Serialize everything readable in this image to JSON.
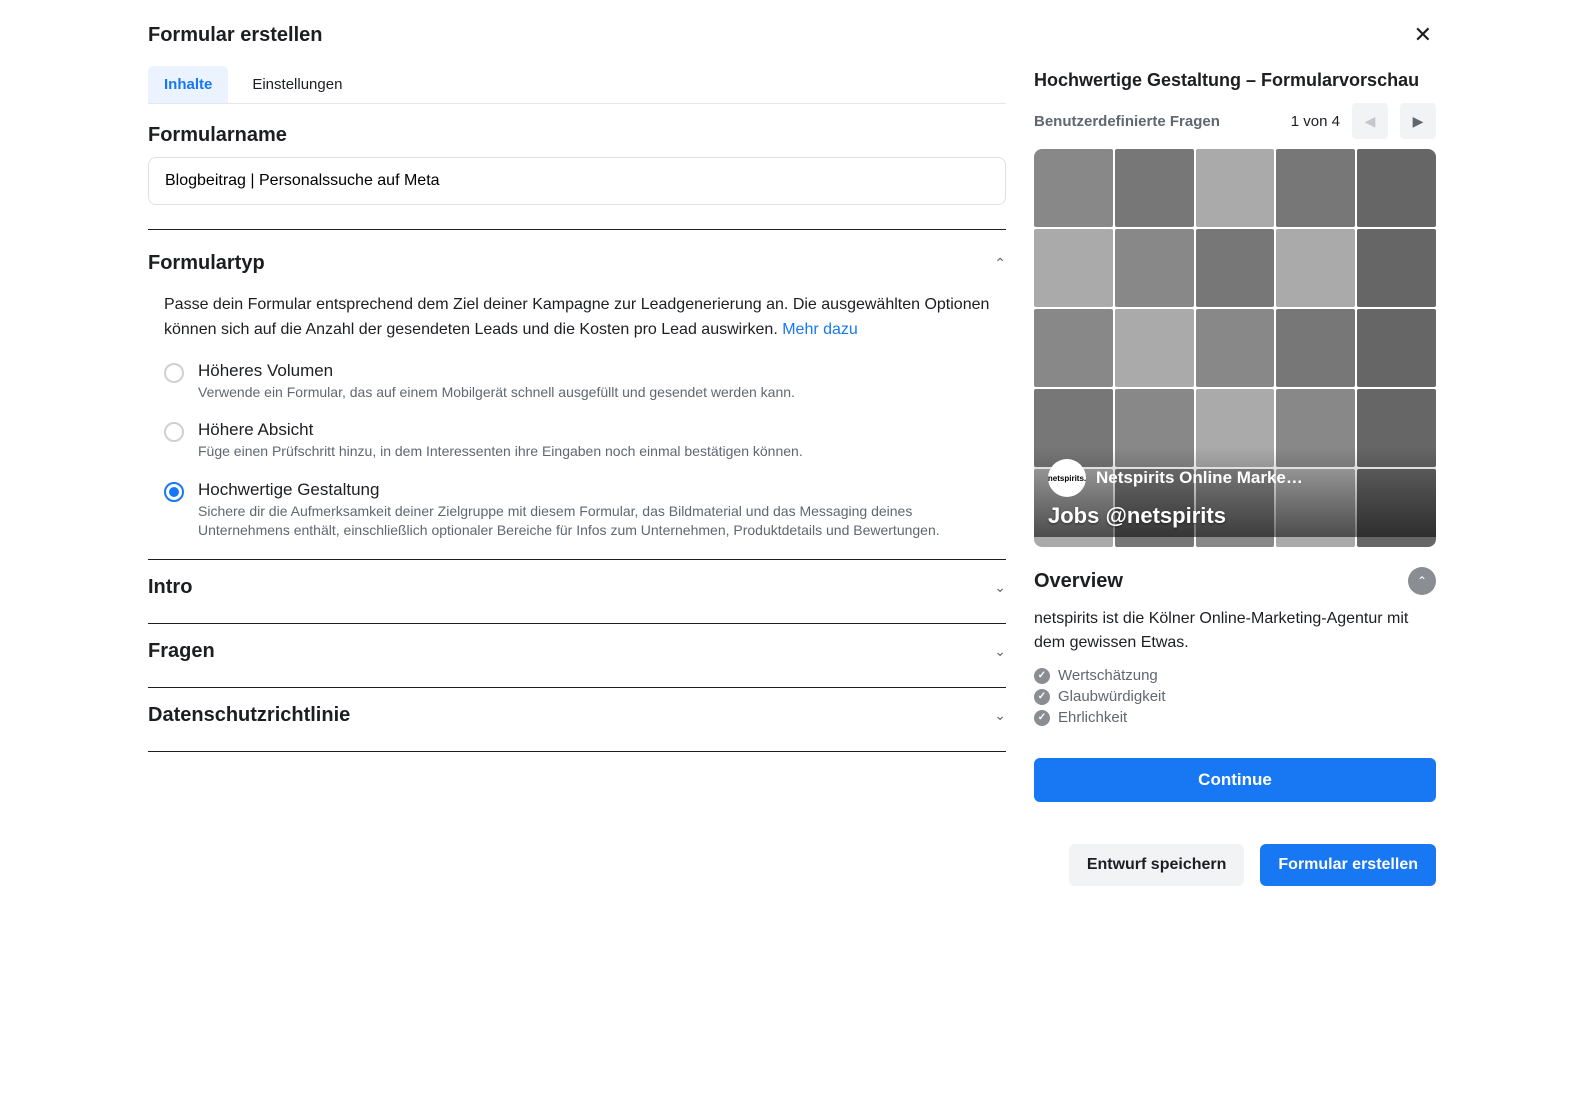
{
  "header": {
    "title": "Formular erstellen"
  },
  "tabs": [
    {
      "label": "Inhalte",
      "active": true
    },
    {
      "label": "Einstellungen",
      "active": false
    }
  ],
  "formName": {
    "label": "Formularname",
    "value": "Blogbeitrag | Personalssuche auf Meta"
  },
  "formType": {
    "heading": "Formulartyp",
    "descriptionPrefix": "Passe dein Formular entsprechend dem Ziel deiner Kampagne zur Leadgenerierung an. Die ausgewählten Optionen können sich auf die Anzahl der gesendeten Leads und die Kosten pro Lead auswirken. ",
    "learnMore": "Mehr dazu",
    "options": [
      {
        "title": "Höheres Volumen",
        "sub": "Verwende ein Formular, das auf einem Mobilgerät schnell ausgefüllt und gesendet werden kann.",
        "selected": false
      },
      {
        "title": "Höhere Absicht",
        "sub": "Füge einen Prüfschritt hinzu, in dem Interessenten ihre Eingaben noch einmal bestätigen können.",
        "selected": false
      },
      {
        "title": "Hochwertige Gestaltung",
        "sub": "Sichere dir die Aufmerksamkeit deiner Zielgruppe mit diesem Formular, das Bildmaterial und das Messaging deines Unternehmens enthält, einschließlich optionaler Bereiche für Infos zum Unternehmen, Produktdetails und Bewertungen.",
        "selected": true
      }
    ]
  },
  "sections": {
    "intro": "Intro",
    "fragen": "Fragen",
    "datenschutz": "Datenschutzrichtlinie"
  },
  "preview": {
    "title": "Hochwertige Gestaltung – Formularvorschau",
    "stepLabel": "Benutzerdefinierte Fragen",
    "stepCount": "1 von 4",
    "brandName": "Netspirits Online Marke…",
    "brandSub": "Jobs @netspirits",
    "overview": {
      "heading": "Overview",
      "text": "netspirits ist die Kölner Online-Marketing-Agentur mit dem gewissen Etwas.",
      "bullets": [
        "Wertschätzung",
        "Glaubwürdigkeit",
        "Ehrlichkeit"
      ]
    },
    "continue": "Continue"
  },
  "footer": {
    "saveDraft": "Entwurf speichern",
    "create": "Formular erstellen"
  }
}
